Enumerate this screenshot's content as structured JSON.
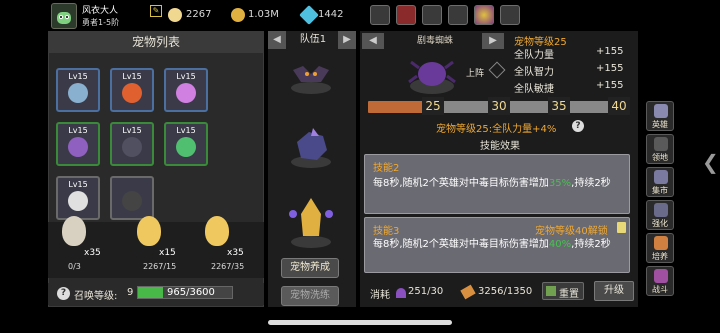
{
  "player": {
    "name": "风衣大人",
    "rank": "勇者1-5阶"
  },
  "resources": [
    {
      "icon": "egg-icon",
      "value": "2267",
      "color": "#f0d890"
    },
    {
      "icon": "gold-coin-icon",
      "value": "1.03M",
      "color": "#e0b040"
    },
    {
      "icon": "gem-icon",
      "value": "1442",
      "color": "#50c0e0"
    }
  ],
  "left_panel": {
    "title": "宠物列表",
    "pets": [
      {
        "level": "Lv15",
        "icon": "skull-pet-icon",
        "border": "#4a6fa0"
      },
      {
        "level": "Lv15",
        "icon": "fire-demon-pet-icon",
        "border": "#4a6fa0"
      },
      {
        "level": "Lv15",
        "icon": "pink-ghost-pet-icon",
        "border": "#4a6fa0"
      },
      {
        "level": "Lv15",
        "icon": "purple-skull-pet-icon",
        "border": "#3a8a3a"
      },
      {
        "level": "Lv15",
        "icon": "bat-pet-icon",
        "border": "#3a8a3a"
      },
      {
        "level": "Lv15",
        "icon": "green-slime-pet-icon",
        "border": "#3a8a3a"
      },
      {
        "level": "Lv15",
        "icon": "white-skeleton-pet-icon",
        "border": "#6a6a6a"
      },
      {
        "level": "",
        "icon": "locked-pet-icon",
        "border": "#6a6a6a"
      }
    ],
    "eggs": [
      {
        "count": "x35",
        "progress": "0/3"
      },
      {
        "count": "x15",
        "progress": "2267/15"
      },
      {
        "count": "x35",
        "progress": "2267/35"
      }
    ],
    "summon_label": "召唤等级:",
    "summon_level": "9",
    "summon_progress": "965/3600"
  },
  "middle_panel": {
    "team_label": "队伍1",
    "buttons": [
      "宠物养成",
      "宠物洗练"
    ]
  },
  "right_panel": {
    "pet_name": "剧毒蜘蛛",
    "pet_level_label": "宠物等级25",
    "stats": [
      {
        "label": "全队力量",
        "value": "+155"
      },
      {
        "label": "全队智力",
        "value": "+155"
      },
      {
        "label": "全队敏捷",
        "value": "+155"
      }
    ],
    "deploy_label": "上阵",
    "level_marks": [
      "25",
      "30",
      "35",
      "40"
    ],
    "level_bonus": "宠物等级25:全队力量+4%",
    "skill_header": "技能效果",
    "skills": [
      {
        "name": "技能2",
        "desc": "每8秒,随机2个英雄对中毒目标伤害增加",
        "pct": "35%",
        "desc2": ",持续2秒",
        "lock": ""
      },
      {
        "name": "技能3",
        "desc": "每8秒,随机2个英雄对中毒目标伤害增加",
        "pct": "40%",
        "desc2": ",持续2秒",
        "lock": "宠物等级40解锁"
      }
    ],
    "cost_label": "消耗",
    "cost1": "251/30",
    "cost2": "3256/1350",
    "reset_label": "重置",
    "upgrade_label": "升级"
  },
  "side_nav": [
    "英雄",
    "领地",
    "集市",
    "强化",
    "培养",
    "战斗"
  ]
}
